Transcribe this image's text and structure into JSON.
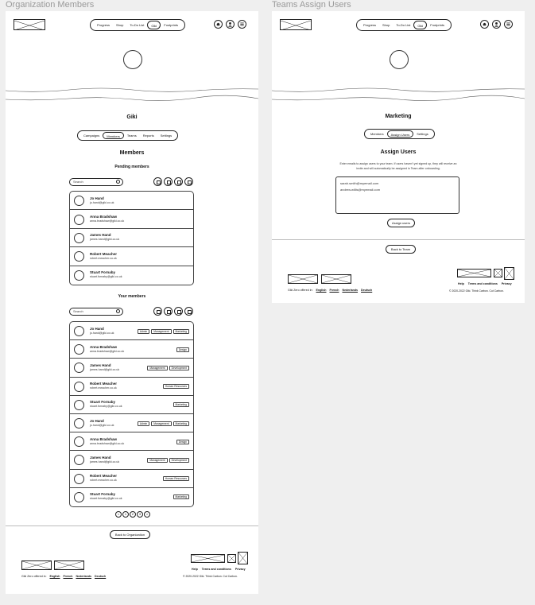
{
  "frames": {
    "left_title": "Organization Members",
    "right_title": "Teams Assign Users"
  },
  "nav": {
    "items": [
      "Progress",
      "Shop",
      "To-Do List",
      "Giki",
      "Footprints"
    ]
  },
  "org": {
    "name": "Giki",
    "tabs": [
      "Campaigns",
      "Members",
      "Teams",
      "Reports",
      "Settings"
    ],
    "members_title": "Members",
    "pending_title": "Pending members",
    "your_title": "Your members",
    "search_placeholder": "Search",
    "pending": [
      {
        "name": "Jo Hand",
        "email": "jo.hand@giki.co.uk"
      },
      {
        "name": "Anna Bradshaw",
        "email": "anna.bradshaw@giki.co.uk"
      },
      {
        "name": "James Hand",
        "email": "james.hand@giki.co.uk"
      },
      {
        "name": "Robert Meacher",
        "email": "robert.meacher.co.uk"
      },
      {
        "name": "Stuart Fornaby",
        "email": "stuart.fornaby@giki.co.uk"
      }
    ],
    "members": [
      {
        "name": "Jo Hand",
        "email": "jo.hand@giki.co.uk",
        "tags": [
          "Admin",
          "Management",
          "Marketing"
        ]
      },
      {
        "name": "Anna Bradshaw",
        "email": "anna.bradshaw@giki.co.uk",
        "tags": [
          "Design"
        ]
      },
      {
        "name": "James Hand",
        "email": "james.hand@giki.co.uk",
        "tags": [
          "Management",
          "Development"
        ]
      },
      {
        "name": "Robert Meacher",
        "email": "robert.meacher.co.uk",
        "tags": [
          "Human Resources"
        ]
      },
      {
        "name": "Stuart Fornaby",
        "email": "stuart.fornaby@giki.co.uk",
        "tags": [
          "Marketing"
        ]
      },
      {
        "name": "Jo Hand",
        "email": "jo.hand@giki.co.uk",
        "tags": [
          "Admin",
          "Management",
          "Marketing"
        ]
      },
      {
        "name": "Anna Bradshaw",
        "email": "anna.bradshaw@giki.co.uk",
        "tags": [
          "Design"
        ]
      },
      {
        "name": "James Hand",
        "email": "james.hand@giki.co.uk",
        "tags": [
          "Management",
          "Development"
        ]
      },
      {
        "name": "Robert Meacher",
        "email": "robert.meacher.co.uk",
        "tags": [
          "Human Resources"
        ]
      },
      {
        "name": "Stuart Fornaby",
        "email": "stuart.fornaby@giki.co.uk",
        "tags": [
          "Marketing"
        ]
      }
    ],
    "pager": [
      "<",
      "1",
      "2",
      "3",
      ">"
    ],
    "back_button": "Back to Organization"
  },
  "team": {
    "name": "Marketing",
    "tabs": [
      "Members",
      "Assign Users",
      "Settings"
    ],
    "title": "Assign Users",
    "description": "Enter emails to assign users to your team. If users haven't yet signed up, they will receive an invite and will automatically be assigned in Team after onboarding.",
    "emails": [
      "sarah.smith@myemail.com",
      "andrew.willis@myemail.com"
    ],
    "assign_button": "Assign users",
    "back_button": "Back to Team"
  },
  "footer": {
    "lang_label": "Giki Zero offered in:",
    "languages": [
      "English",
      "French",
      "Nederlands",
      "Deutsch"
    ],
    "links": [
      "Help",
      "Terms and conditions",
      "Privacy"
    ],
    "copyright": "© 2020-2022 Giki. Think Carbon. Cut Carbon."
  }
}
